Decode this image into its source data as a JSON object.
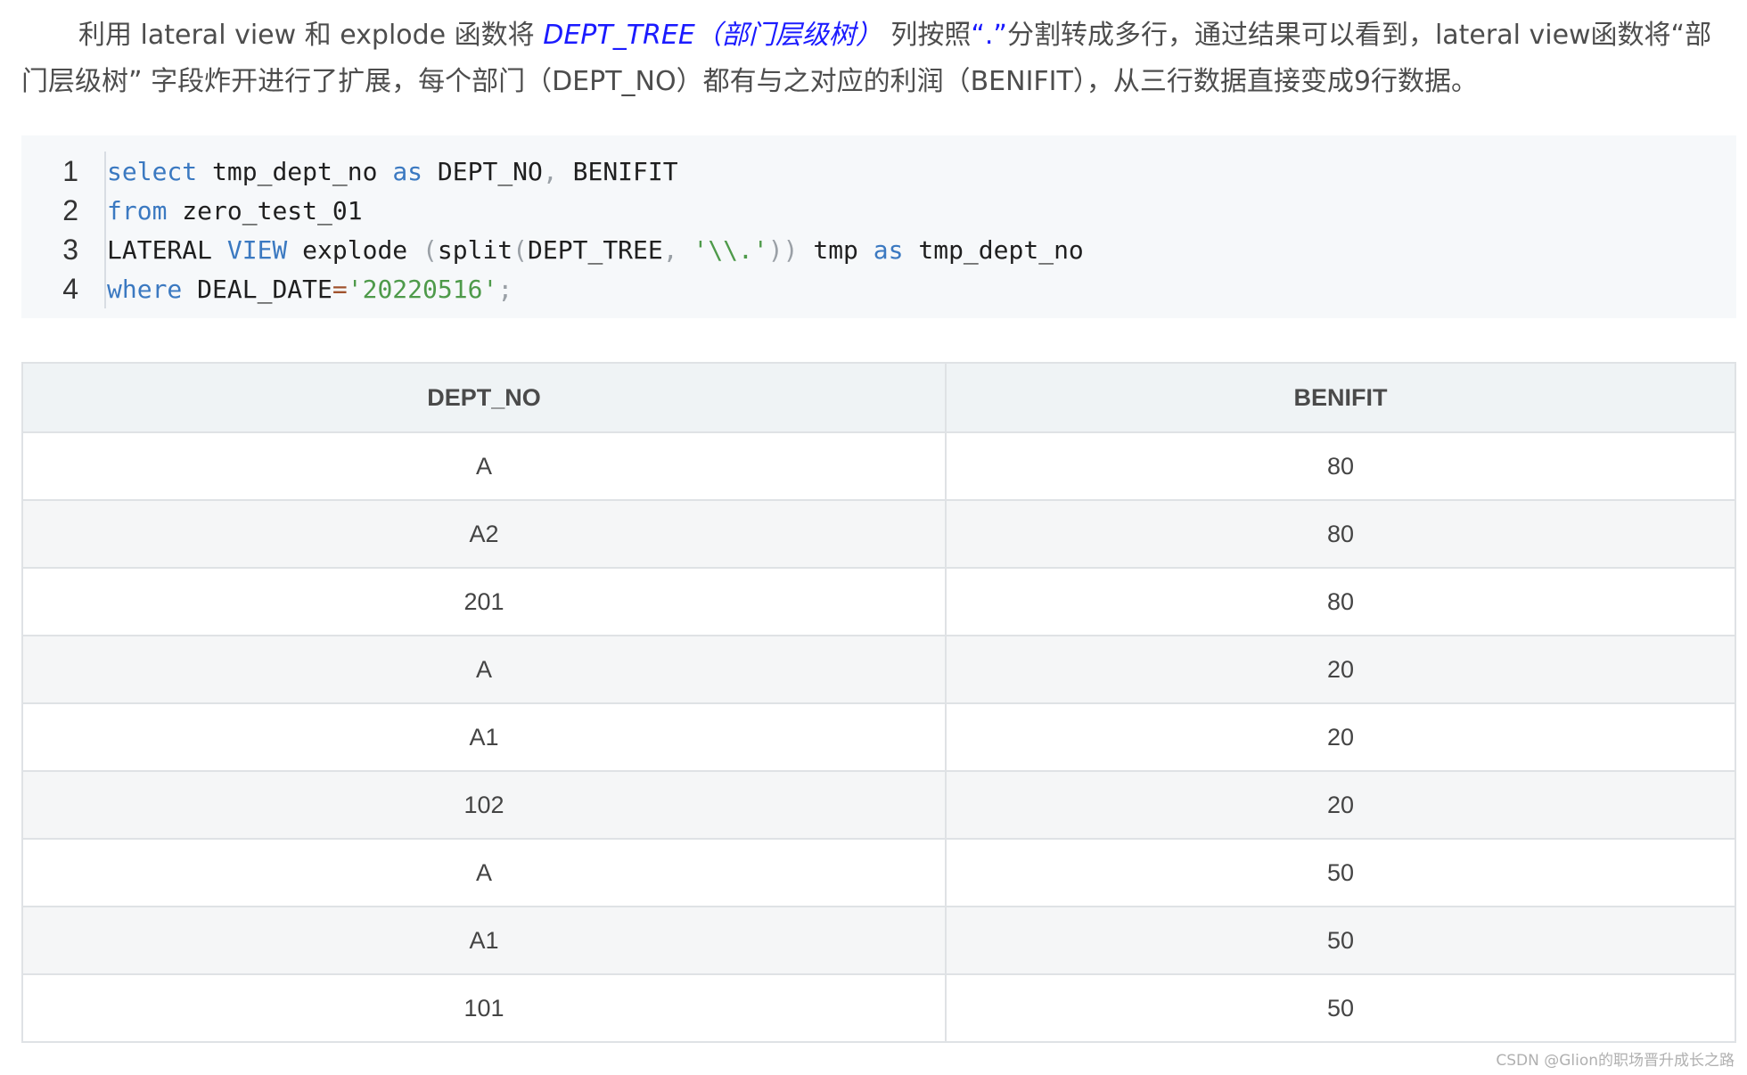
{
  "paragraph": {
    "before": "利用 lateral view 和 explode 函数将 ",
    "highlight": "DEPT_TREE（部门层级树）",
    "middle": " 列按照",
    "quote_dot": "“.”",
    "after": "分割转成多行，通过结果可以看到，lateral view函数将“部门层级树” 字段炸开进行了扩展，每个部门（DEPT_NO）都有与之对应的利润（BENIFIT），从三行数据直接变成9行数据。"
  },
  "code": {
    "line_numbers": [
      "1",
      "2",
      "3",
      "4"
    ],
    "line1": {
      "kw1": "select",
      "t1": " tmp_dept_no ",
      "kw2": "as",
      "t2": " DEPT_NO",
      "p1": ",",
      "t3": " BENIFIT"
    },
    "line2": {
      "kw1": "from",
      "t1": " zero_test_01"
    },
    "line3": {
      "t1": "LATERAL ",
      "kw1": "VIEW",
      "t2": " explode ",
      "p1": "(",
      "t3": "split",
      "p2": "(",
      "t4": "DEPT_TREE",
      "p3": ",",
      "t5": " ",
      "s1": "'\\\\.'",
      "p4": "))",
      "t6": " tmp ",
      "kw2": "as",
      "t7": " tmp_dept_no"
    },
    "line4": {
      "kw1": "where",
      "t1": " DEAL_DATE",
      "o1": "=",
      "s1": "'20220516'",
      "p1": ";"
    }
  },
  "table": {
    "headers": [
      "DEPT_NO",
      "BENIFIT"
    ],
    "rows": [
      [
        "A",
        "80"
      ],
      [
        "A2",
        "80"
      ],
      [
        "201",
        "80"
      ],
      [
        "A",
        "20"
      ],
      [
        "A1",
        "20"
      ],
      [
        "102",
        "20"
      ],
      [
        "A",
        "50"
      ],
      [
        "A1",
        "50"
      ],
      [
        "101",
        "50"
      ]
    ]
  },
  "watermark": "CSDN @Glion的职场晋升成长之路",
  "colors": {
    "highlight": "#1b1bff",
    "keyword": "#3b79c1",
    "string": "#4e9a4a",
    "code_bg": "#f6f8fa",
    "header_bg": "#eff3f5"
  }
}
